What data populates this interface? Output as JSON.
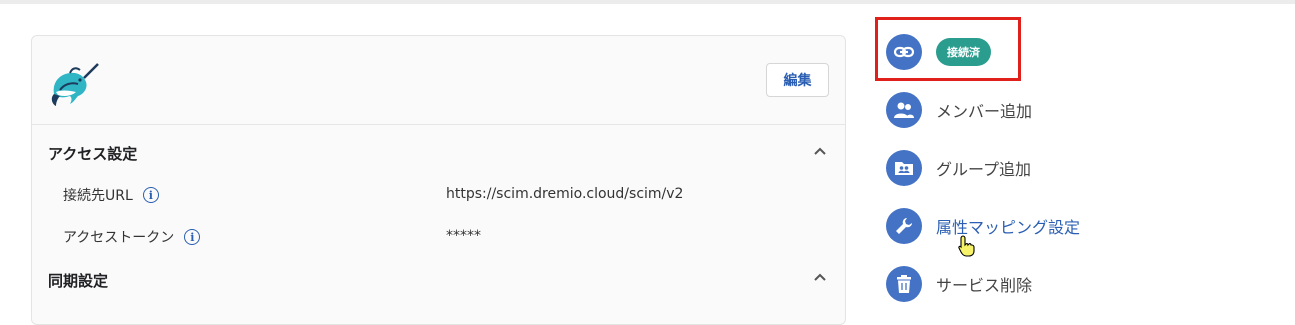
{
  "card": {
    "edit_label": "編集",
    "access_section": {
      "title": "アクセス設定",
      "rows": [
        {
          "label": "接続先URL",
          "value": "https://scim.dremio.cloud/scim/v2"
        },
        {
          "label": "アクセストークン",
          "value": "*****"
        }
      ]
    },
    "sync_section": {
      "title": "同期設定"
    }
  },
  "actions": {
    "status_badge": "接続済",
    "items": [
      {
        "label": "メンバー追加",
        "icon": "users-icon"
      },
      {
        "label": "グループ追加",
        "icon": "group-folder-icon"
      },
      {
        "label": "属性マッピング設定",
        "icon": "wrench-icon"
      },
      {
        "label": "サービス削除",
        "icon": "trash-icon"
      }
    ]
  },
  "colors": {
    "accent_blue": "#4472c4",
    "link_blue": "#2b5fb3",
    "badge_teal": "#2a9d8f",
    "highlight_red": "#e0201b"
  }
}
